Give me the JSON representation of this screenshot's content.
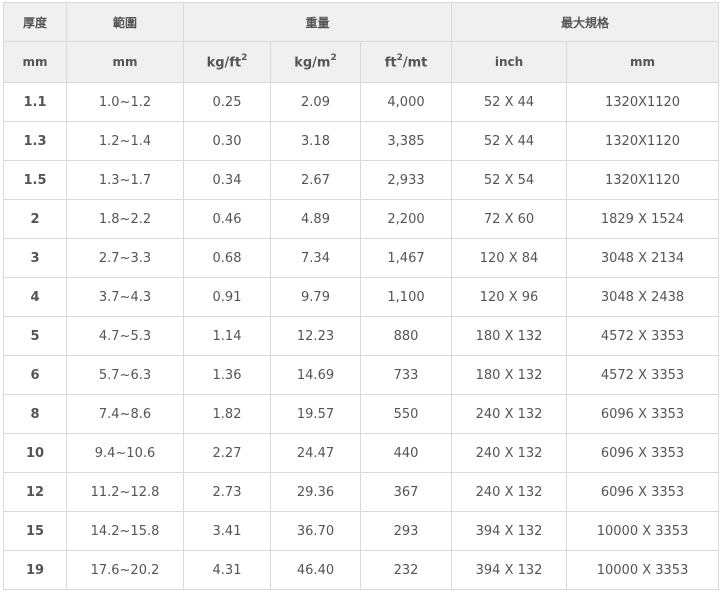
{
  "header_groups": {
    "thickness": "厚度",
    "range": "範圍",
    "weight": "重量",
    "max_size": "最大規格"
  },
  "header_units": {
    "thickness": "mm",
    "range": "mm",
    "kgft_base": "kg/ft",
    "kgft_sup": "2",
    "kgm_base": "kg/m",
    "kgm_sup": "2",
    "ftmt_base": "ft",
    "ftmt_sup": "2",
    "ftmt_tail": "/mt",
    "inch": "inch",
    "mm": "mm"
  },
  "rows": [
    {
      "thickness": "1.1",
      "range": "1.0~1.2",
      "kg_ft2": "0.25",
      "kg_m2": "2.09",
      "ft2_mt": "4,000",
      "inch": "52 X 44",
      "mm": "1320X1120"
    },
    {
      "thickness": "1.3",
      "range": "1.2~1.4",
      "kg_ft2": "0.30",
      "kg_m2": "3.18",
      "ft2_mt": "3,385",
      "inch": "52 X 44",
      "mm": "1320X1120"
    },
    {
      "thickness": "1.5",
      "range": "1.3~1.7",
      "kg_ft2": "0.34",
      "kg_m2": "2.67",
      "ft2_mt": "2,933",
      "inch": "52 X 54",
      "mm": "1320X1120"
    },
    {
      "thickness": "2",
      "range": "1.8~2.2",
      "kg_ft2": "0.46",
      "kg_m2": "4.89",
      "ft2_mt": "2,200",
      "inch": "72 X 60",
      "mm": "1829 X 1524"
    },
    {
      "thickness": "3",
      "range": "2.7~3.3",
      "kg_ft2": "0.68",
      "kg_m2": "7.34",
      "ft2_mt": "1,467",
      "inch": "120 X 84",
      "mm": "3048 X 2134"
    },
    {
      "thickness": "4",
      "range": "3.7~4.3",
      "kg_ft2": "0.91",
      "kg_m2": "9.79",
      "ft2_mt": "1,100",
      "inch": "120 X 96",
      "mm": "3048 X 2438"
    },
    {
      "thickness": "5",
      "range": "4.7~5.3",
      "kg_ft2": "1.14",
      "kg_m2": "12.23",
      "ft2_mt": "880",
      "inch": "180 X 132",
      "mm": "4572 X 3353"
    },
    {
      "thickness": "6",
      "range": "5.7~6.3",
      "kg_ft2": "1.36",
      "kg_m2": "14.69",
      "ft2_mt": "733",
      "inch": "180 X 132",
      "mm": "4572 X 3353"
    },
    {
      "thickness": "8",
      "range": "7.4~8.6",
      "kg_ft2": "1.82",
      "kg_m2": "19.57",
      "ft2_mt": "550",
      "inch": "240 X 132",
      "mm": "6096 X 3353"
    },
    {
      "thickness": "10",
      "range": "9.4~10.6",
      "kg_ft2": "2.27",
      "kg_m2": "24.47",
      "ft2_mt": "440",
      "inch": "240 X 132",
      "mm": "6096 X 3353"
    },
    {
      "thickness": "12",
      "range": "11.2~12.8",
      "kg_ft2": "2.73",
      "kg_m2": "29.36",
      "ft2_mt": "367",
      "inch": "240 X 132",
      "mm": "6096 X 3353"
    },
    {
      "thickness": "15",
      "range": "14.2~15.8",
      "kg_ft2": "3.41",
      "kg_m2": "36.70",
      "ft2_mt": "293",
      "inch": "394 X 132",
      "mm": "10000 X 3353"
    },
    {
      "thickness": "19",
      "range": "17.6~20.2",
      "kg_ft2": "4.31",
      "kg_m2": "46.40",
      "ft2_mt": "232",
      "inch": "394 X 132",
      "mm": "10000 X 3353"
    }
  ]
}
